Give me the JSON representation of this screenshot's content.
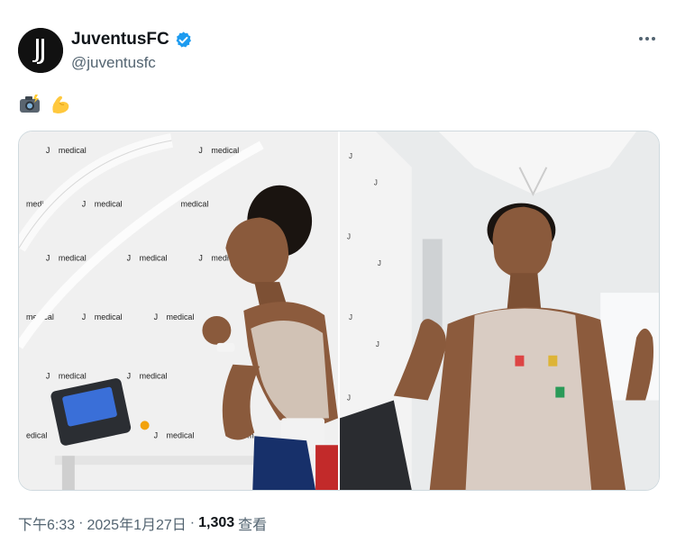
{
  "tweet": {
    "author": {
      "display_name": "JuventusFC",
      "handle": "@juventusfc",
      "verified": true,
      "avatar_icon": "juventus-j-logo",
      "avatar_color": "#111111"
    },
    "text_emojis": [
      "camera-with-flash-emoji",
      "flexed-biceps-emoji"
    ],
    "media": {
      "count": 2,
      "wall_text": "medical",
      "photos": [
        {
          "label": "player-running-on-treadmill"
        },
        {
          "label": "player-thumbs-up-with-electrodes"
        }
      ]
    },
    "meta": {
      "time": "下午6:33",
      "separator": "·",
      "date": "2025年1月27日",
      "views_count": "1,303",
      "views_label": "查看"
    },
    "colors": {
      "verified_blue": "#1d9bf0",
      "secondary_text": "#536471",
      "primary_text": "#0f1419"
    }
  }
}
